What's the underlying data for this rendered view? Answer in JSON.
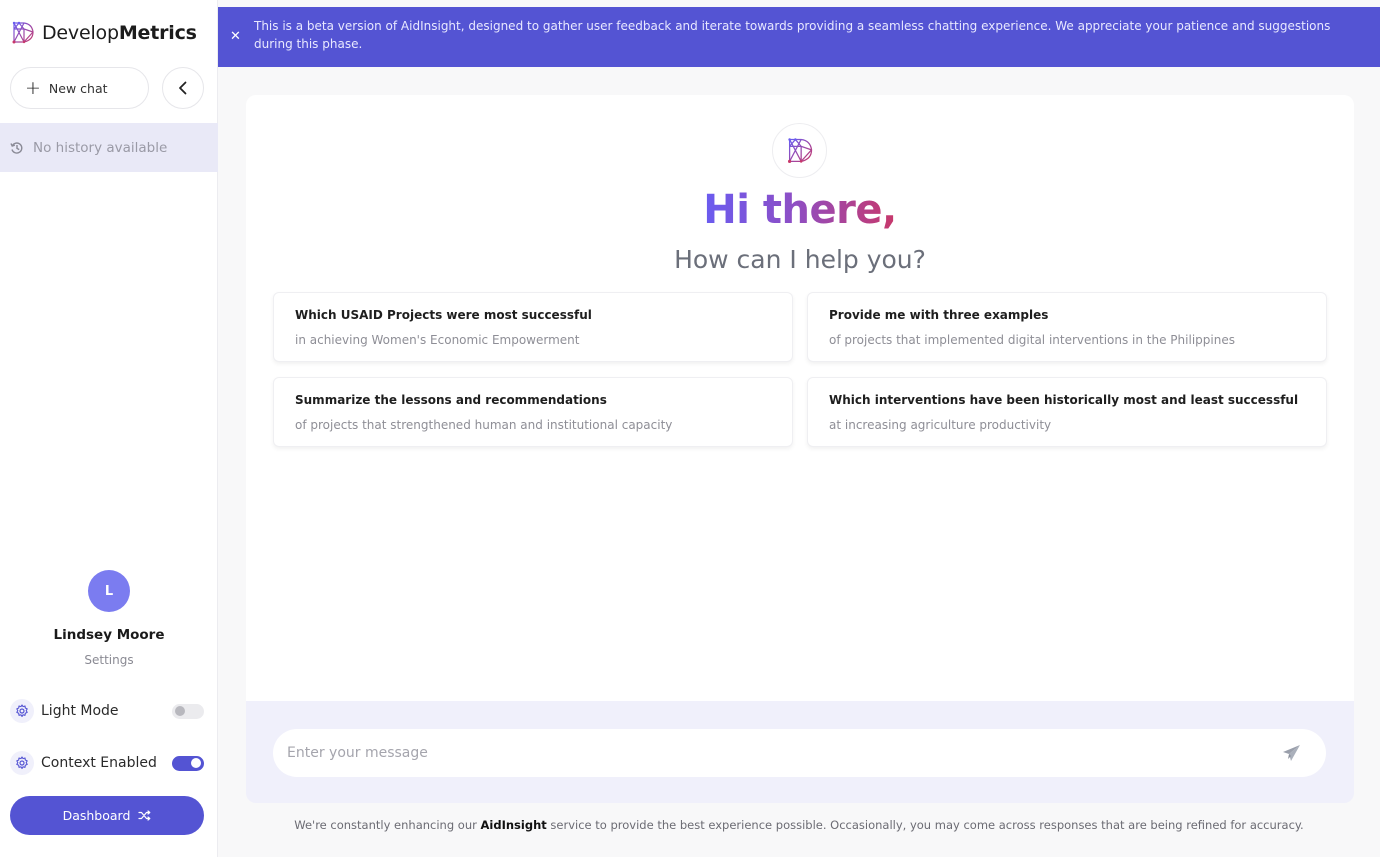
{
  "brand": {
    "name_light": "Develop",
    "name_bold": "Metrics",
    "logo_icon": "developmetrics-logo-icon"
  },
  "sidebar": {
    "new_chat_label": "New chat",
    "new_chat_icon": "plus-icon",
    "collapse_icon": "chevron-left-icon",
    "history_icon": "history-icon",
    "history_empty_text": "No history available",
    "user": {
      "initial": "L",
      "name": "Lindsey Moore",
      "settings_label": "Settings"
    },
    "toggles": [
      {
        "label": "Light Mode",
        "icon": "gear-icon",
        "enabled": false
      },
      {
        "label": "Context Enabled",
        "icon": "gear-icon",
        "enabled": true
      }
    ],
    "dashboard_label": "Dashboard",
    "dashboard_icon": "shuffle-icon"
  },
  "banner": {
    "close_icon": "close-icon",
    "text": "This is a beta version of AidInsight, designed to gather user feedback and iterate towards providing a seamless chatting experience. We appreciate your patience and suggestions during this phase."
  },
  "hero": {
    "title": "Hi there,",
    "subtitle": "How can I help you?"
  },
  "suggestions": [
    {
      "title": "Which USAID Projects were most successful",
      "subtitle": "in achieving Women's Economic Empowerment"
    },
    {
      "title": "Provide me with three examples",
      "subtitle": "of projects that implemented digital interventions in the Philippines"
    },
    {
      "title": "Summarize the lessons and recommendations",
      "subtitle": "of projects that strengthened human and institutional capacity"
    },
    {
      "title": "Which interventions have been historically most and least successful",
      "subtitle": "at increasing agriculture productivity"
    }
  ],
  "composer": {
    "placeholder": "Enter your message",
    "value": "",
    "send_icon": "send-icon"
  },
  "footer": {
    "before": "We're constantly enhancing our ",
    "brand": "AidInsight",
    "after": " service to provide the best experience possible. Occasionally, you may come across responses that are being refined for accuracy."
  },
  "colors": {
    "accent": "#5454d3",
    "avatar": "#7b7cf0",
    "history_bg": "#e9e9f7",
    "input_area_bg": "#f0f0fb",
    "gradient_start": "#6a5cf0",
    "gradient_end": "#c8386a"
  }
}
